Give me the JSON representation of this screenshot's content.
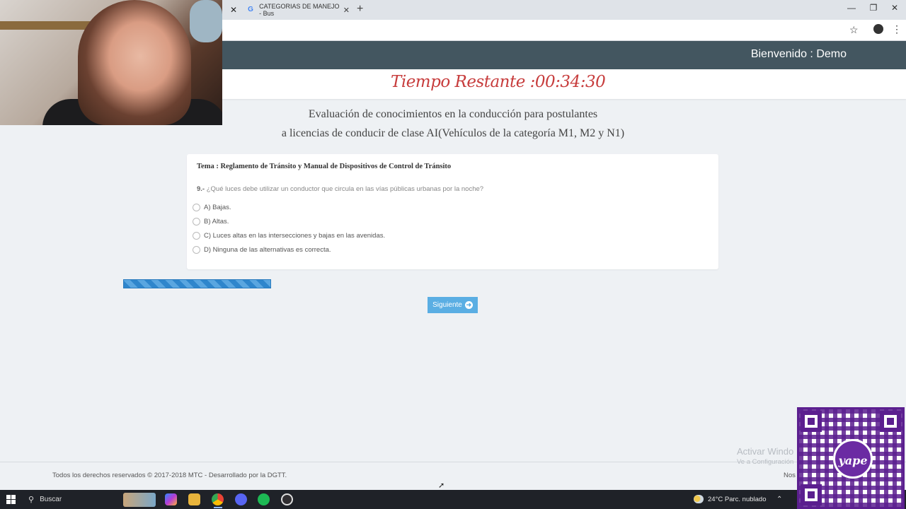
{
  "browser": {
    "tab_title": "CATEGORIAS DE MANEJO - Bus",
    "active_tab_close": "✕",
    "tab_close": "✕",
    "new_tab": "+",
    "window_controls": [
      "—",
      "❐",
      "✕"
    ],
    "icons": [
      "google-g-icon",
      "star-icon",
      "profile-avatar-icon",
      "kebab-menu-icon"
    ]
  },
  "header": {
    "welcome": "Bienvenido : Demo"
  },
  "timer": {
    "label": "Tiempo Restante :00:34:30"
  },
  "exam": {
    "title_line1": "Evaluación de conocimientos en la conducción para postulantes",
    "title_line2": "a licencias de conducir de clase AI(Vehículos de la categoría M1, M2 y N1)"
  },
  "question": {
    "topic": "Tema : Reglamento de Tránsito y Manual de Dispositivos de Control de Tránsito",
    "number": "9.-",
    "text": "¿Qué luces debe utilizar un conductor que circula en las vías públicas urbanas por la noche?",
    "options": [
      "A) Bajas.",
      "B) Altas.",
      "C) Luces altas en las intersecciones y bajas en las avenidas.",
      "D) Ninguna de las alternativas es correcta."
    ]
  },
  "progress": {
    "fraction": 0.25,
    "color": "#2f86cc"
  },
  "next_button": {
    "label": "Siguiente",
    "icon": "arrow-right-icon"
  },
  "footer": {
    "copyright": "Todos los derechos reservados © 2017-2018 MTC - Desarrollado por la DGTT.",
    "right_text": "Nos"
  },
  "watermark": {
    "title": "Activar Windo",
    "subtitle": "Ve a Configuración"
  },
  "qr_overlay": {
    "logo_text": "yape"
  },
  "taskbar": {
    "search_label": "Buscar",
    "weather": "24°C  Parc. nublado",
    "apps": [
      "copilot-icon",
      "file-explorer-icon",
      "chrome-icon",
      "discord-icon",
      "spotify-icon",
      "obs-icon"
    ]
  },
  "colors": {
    "header_bg": "#435660",
    "timer_red": "#c73c3c",
    "button_blue": "#5aaee3",
    "qr_purple": "#5b1f8f"
  }
}
